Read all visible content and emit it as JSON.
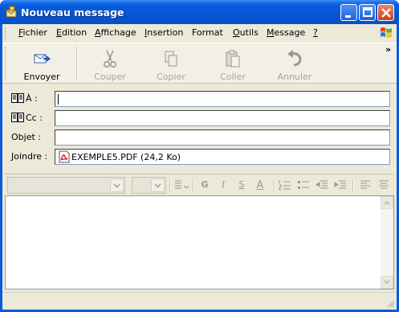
{
  "window": {
    "title": "Nouveau message"
  },
  "menu": {
    "items": [
      {
        "pre": "",
        "u": "F",
        "post": "ichier"
      },
      {
        "pre": "",
        "u": "E",
        "post": "dition"
      },
      {
        "pre": "",
        "u": "A",
        "post": "ffichage"
      },
      {
        "pre": "",
        "u": "I",
        "post": "nsertion"
      },
      {
        "pre": "",
        "u": "",
        "post": "Format"
      },
      {
        "pre": "",
        "u": "O",
        "post": "utils"
      },
      {
        "pre": "",
        "u": "M",
        "post": "essage"
      },
      {
        "pre": "",
        "u": "?",
        "post": ""
      }
    ]
  },
  "toolbar": {
    "send": "Envoyer",
    "cut": "Couper",
    "copy": "Copier",
    "paste": "Coller",
    "undo": "Annuler",
    "overflow": "»"
  },
  "headers": {
    "to_label": "À :",
    "cc_label": "Cc :",
    "subject_label": "Objet :",
    "attach_label": "Joindre :",
    "to_value": "",
    "cc_value": "",
    "subject_value": "",
    "attachment": "EXEMPLE5.PDF (24,2 Ko)"
  },
  "format": {
    "bold": "G",
    "italic": "I",
    "underline": "S",
    "font_color": "A"
  },
  "colors": {
    "titlebar": "#0654d4",
    "client": "#ece9d8"
  }
}
